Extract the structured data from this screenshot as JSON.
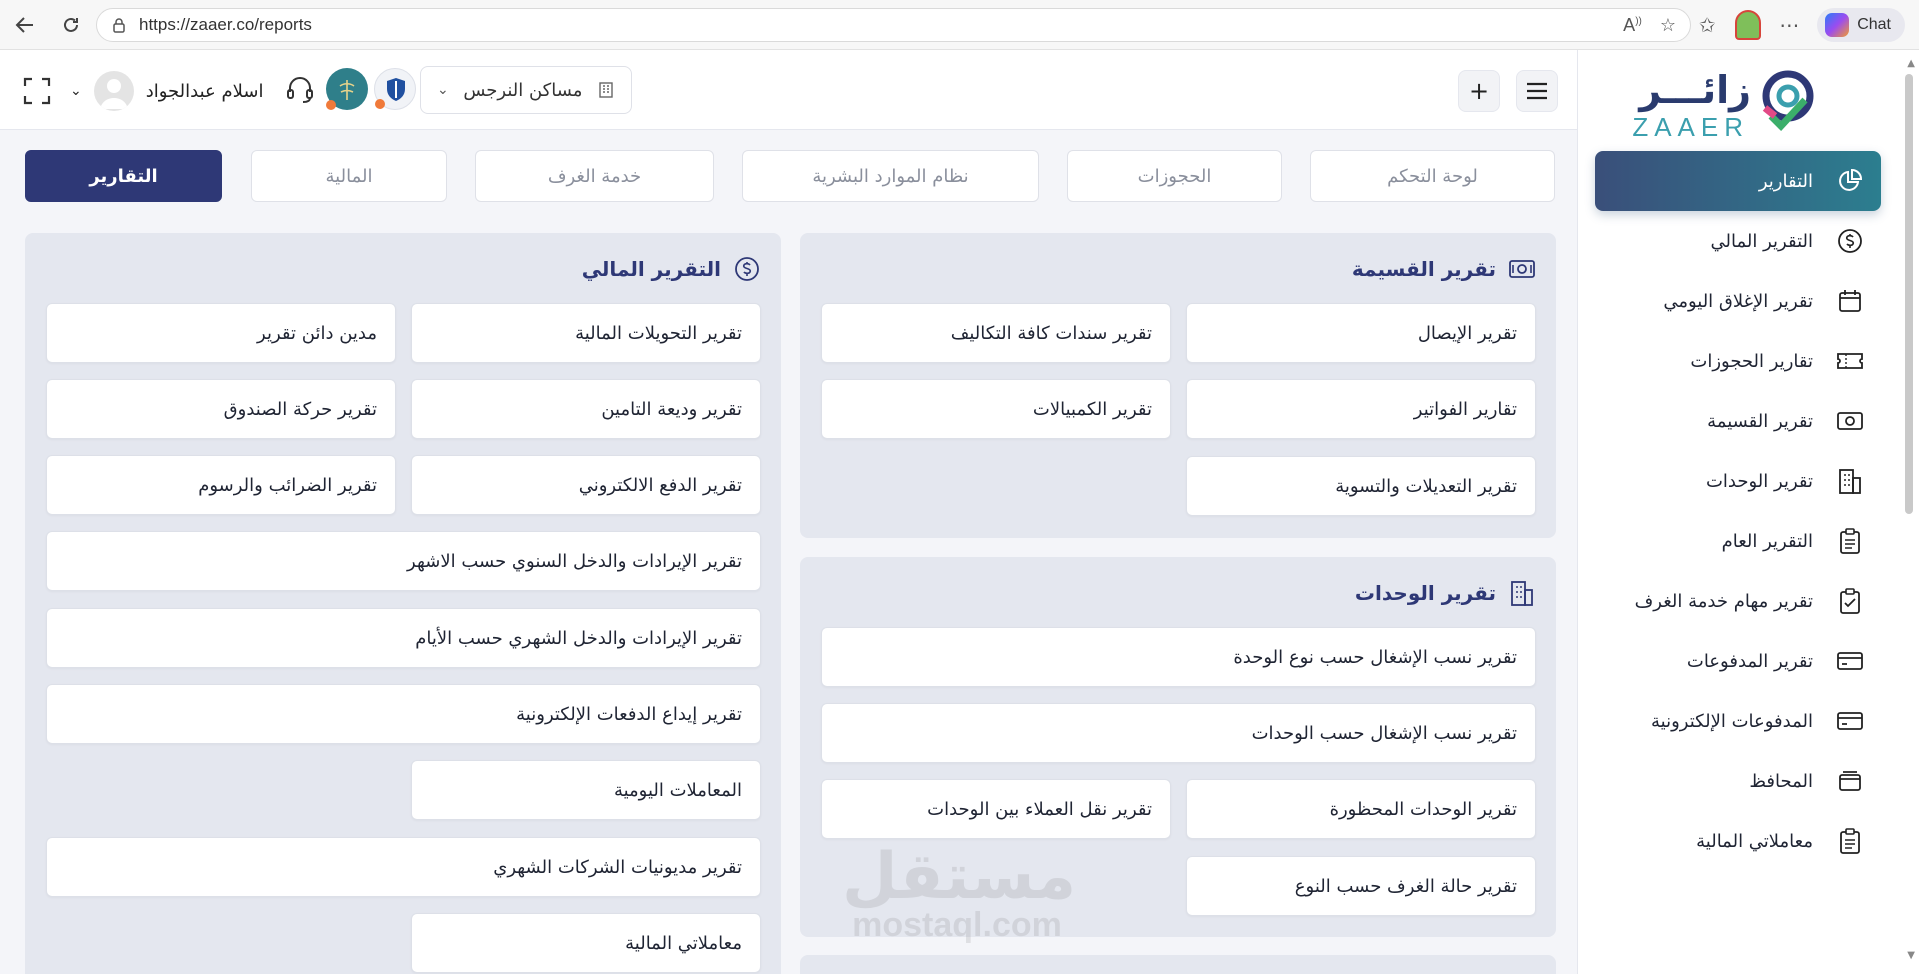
{
  "browser": {
    "url": "https://zaaer.co/reports",
    "chat_label": "Chat"
  },
  "brand": {
    "name_ar": "زائـــر",
    "name_en": "ZAAER",
    "primary": "#2e3876",
    "accent": "#3b9fae"
  },
  "header": {
    "property_name": "مساكن النرجس",
    "user_name": "اسلام عبدالجواد"
  },
  "tabs": [
    {
      "label": "لوحة التحكم"
    },
    {
      "label": "الحجوزات"
    },
    {
      "label": "نظام الموارد البشرية"
    },
    {
      "label": "خدمة الغرف"
    },
    {
      "label": "المالية"
    },
    {
      "label": "التقارير",
      "active": true
    }
  ],
  "sidebar": {
    "items": [
      {
        "label": "التقارير",
        "icon": "pie-chart-icon",
        "active": true
      },
      {
        "label": "التقرير المالي",
        "icon": "dollar-icon"
      },
      {
        "label": "تقرير الإغلاق اليومي",
        "icon": "calendar-icon"
      },
      {
        "label": "تقارير الحجوزات",
        "icon": "ticket-icon"
      },
      {
        "label": "تقرير القسيمة",
        "icon": "voucher-icon"
      },
      {
        "label": "تقرير الوحدات",
        "icon": "building-icon"
      },
      {
        "label": "التقرير العام",
        "icon": "clipboard-icon"
      },
      {
        "label": "تقرير مهام خدمة الغرف",
        "icon": "clipboard-check-icon"
      },
      {
        "label": "تقرير المدفوعات",
        "icon": "card-icon"
      },
      {
        "label": "المدفوعات الإلكترونية",
        "icon": "card-icon"
      },
      {
        "label": "المحافظ",
        "icon": "wallet-icon"
      },
      {
        "label": "معاملاتي المالية",
        "icon": "clipboard-icon"
      }
    ]
  },
  "voucher_card": {
    "title": "تقرير القسيمة",
    "items": [
      "تقرير الإيصال",
      "تقرير سندات كافة التكاليف",
      "تقارير الفواتير",
      "تقرير الكمبيالات",
      "تقرير التعديلات والتسوية"
    ]
  },
  "units_card": {
    "title": "تقرير الوحدات",
    "items": [
      "تقرير نسب الإشغال حسب نوع الوحدة",
      "تقرير نسب الإشغال حسب الوحدات",
      "تقرير الوحدات المحظورة",
      "تقرير نقل العملاء بين الوحدات",
      "تقرير حالة الغرف حسب النوع"
    ]
  },
  "financial_card": {
    "title": "التقرير المالي",
    "items": [
      "تقرير التحويلات المالية",
      "مدين دائن تقرير",
      "تقرير وديعة التامين",
      "تقرير حركة الصندوق",
      "تقرير الدفع الالكتروني",
      "تقرير الضرائب والرسوم",
      "تقرير الإيرادات والدخل السنوي حسب الاشهر",
      "تقرير الإيرادات والدخل الشهري حسب الأيام",
      "تقرير إيداع الدفعات الإلكترونية",
      "المعاملات اليومية",
      "تقرير مديونيات الشركات الشهري",
      "معاملاتي المالية"
    ]
  },
  "watermark": {
    "ar": "مستقل",
    "en": "mostaql.com"
  }
}
